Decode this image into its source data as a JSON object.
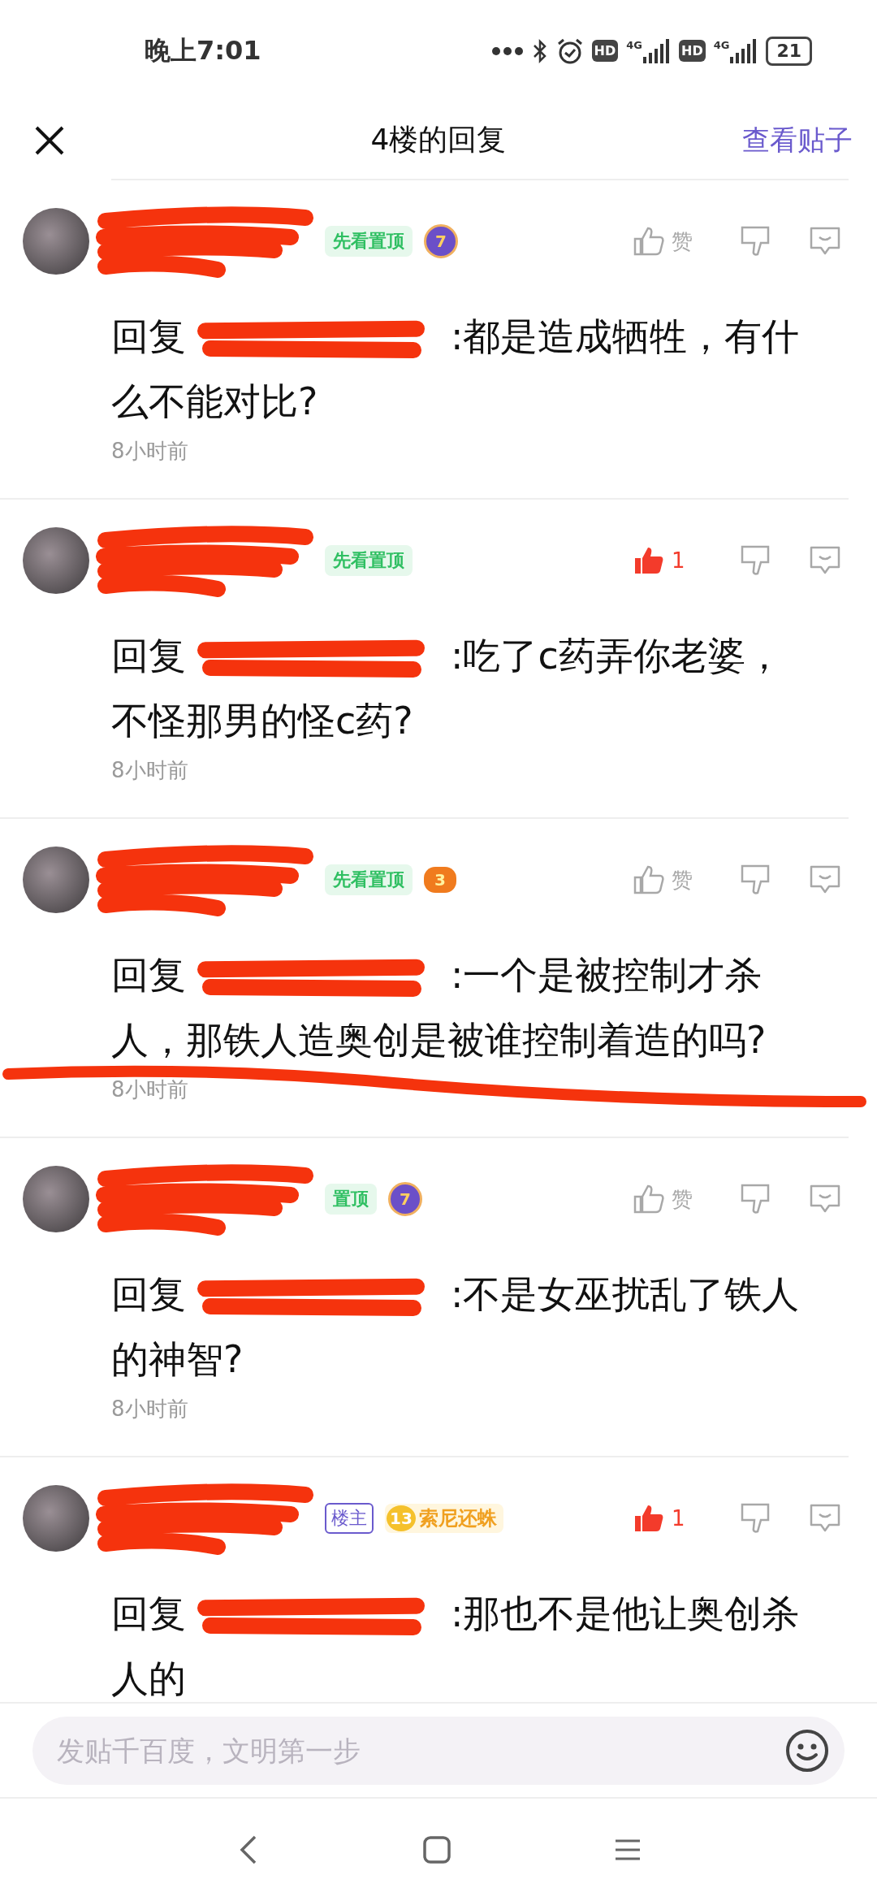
{
  "status_bar": {
    "time": "晚上7:01",
    "hd_1": "HD",
    "network_1": "4G",
    "hd_2": "HD",
    "network_2": "4G",
    "battery": "21"
  },
  "header": {
    "title": "4楼的回复",
    "link": "查看贴子"
  },
  "comments": [
    {
      "badges": [
        {
          "kind": "pin",
          "label": "先看置顶"
        },
        {
          "kind": "level",
          "label": "7"
        }
      ],
      "like": {
        "selected": false,
        "label": "赞"
      },
      "reply_label": "回复",
      "text": ":都是造成牺牲，有什么不能对比?",
      "time": "8小时前",
      "strikeline": false
    },
    {
      "badges": [
        {
          "kind": "pin",
          "label": "先看置顶"
        }
      ],
      "like": {
        "selected": true,
        "label": "1"
      },
      "reply_label": "回复",
      "text": ":吃了c药弄你老婆，不怪那男的怪c药?",
      "time": "8小时前",
      "strikeline": false
    },
    {
      "badges": [
        {
          "kind": "pin",
          "label": "先看置顶"
        },
        {
          "kind": "game",
          "label": "3"
        }
      ],
      "like": {
        "selected": false,
        "label": "赞"
      },
      "reply_label": "回复",
      "text": ":一个是被控制才杀人，那铁人造奥创是被谁控制着造的吗?",
      "time": "8小时前",
      "strikeline": true
    },
    {
      "badges": [
        {
          "kind": "pin",
          "label": "置顶"
        },
        {
          "kind": "level",
          "label": "7"
        }
      ],
      "like": {
        "selected": false,
        "label": "赞"
      },
      "reply_label": "回复",
      "text": ":不是女巫扰乱了铁人的神智?",
      "time": "8小时前",
      "strikeline": false
    },
    {
      "badges": [
        {
          "kind": "owner",
          "label": "楼主"
        },
        {
          "kind": "fan",
          "level": "13",
          "label": "索尼还蛛"
        }
      ],
      "like": {
        "selected": true,
        "label": "1"
      },
      "reply_label": "回复",
      "text": ":那也不是他让奥创杀人的",
      "strikeline": false
    }
  ],
  "composer": {
    "placeholder": "发贴千百度，文明第一步"
  }
}
